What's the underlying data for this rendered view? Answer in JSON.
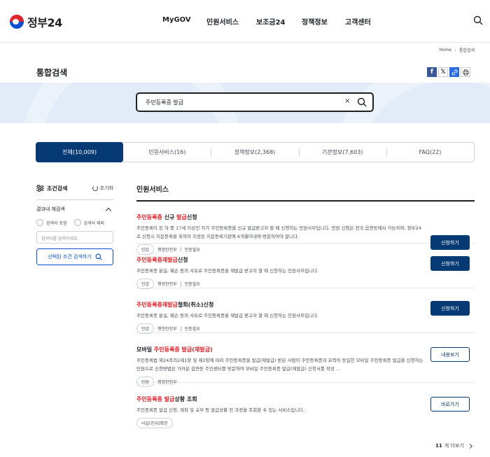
{
  "header": {
    "logo_text": "정부24",
    "nav": [
      "MyGOV",
      "민원서비스",
      "보조금24",
      "정책정보",
      "고객센터"
    ]
  },
  "breadcrumb": [
    "Home",
    "통합검색"
  ],
  "page_title": "통합검색",
  "search": {
    "value": "주민등록증 발급"
  },
  "tabs": [
    {
      "label": "전체(10,009)",
      "active": true
    },
    {
      "label": "민원서비스(16)",
      "active": false
    },
    {
      "label": "정책정보(2,368)",
      "active": false
    },
    {
      "label": "기관정보(7,603)",
      "active": false
    },
    {
      "label": "FAQ(22)",
      "active": false
    }
  ],
  "filter": {
    "title": "조건검색",
    "reset": "초기화",
    "section": "결과내 재검색",
    "option_include": "검색어 포함",
    "option_exclude": "검색어 제외",
    "input_placeholder": "검색어를 입력하세요.",
    "apply_button": "선택된 조건 검색하기"
  },
  "results": {
    "section_title": "민원서비스",
    "items": [
      {
        "title_pre": "",
        "title_hl1": "주민등록증",
        "title_mid": " 신규 ",
        "title_hl2": "발급",
        "title_post": "신청",
        "desc": "주민등록이 된 자 중 17세 이상인 자가 주민등록증을 신규 발급받고자 할 때 신청하는 민원사무입니다. 민원 신청은 전국 읍면동에서 가능하며, 정부24로 신청시 지문등록을 위하여 지정된 지문등록기관에 6개월이내에 방문하여야 합니다.",
        "badge": "인감",
        "agency": "행정안전부",
        "auth": "인증필요",
        "action": "신청하기"
      },
      {
        "title_pre": "",
        "title_hl1": "주민등록증",
        "title_mid": "재",
        "title_hl2": "발급",
        "title_post": "신청",
        "desc": "주민등록증 분실, 훼손 등의 사유로 주민등록증을 재발급 받고자 할 때 신청하는 민원사무입니다.",
        "badge": "인감",
        "agency": "행정안전부",
        "auth": "인증필요",
        "action": "신청하기"
      },
      {
        "title_pre": "",
        "title_hl1": "주민등록증",
        "title_mid": "재",
        "title_hl2": "발급",
        "title_post": "철회(취소)신청",
        "desc": "주민등록증 분실, 훼손 등의 사유로 주민등록증을 재발급 받고자 할 때 신청하는 민원사무입니다.",
        "badge": "인감",
        "agency": "행정안전부",
        "auth": "인증필요",
        "action": "신청하기"
      },
      {
        "title_pre": "모바일 ",
        "title_hl1": "주민등록증",
        "title_mid": " ",
        "title_hl2": "발급",
        "title_post": "(재발급)",
        "desc": "주민등록법 제24조의2제1항 및 제2항에 따라 주민등록증을 발급(재발급) 받은 사람이 주민등록증과 효력이 동일한 모바일 주민등록증 발급을 신청하는 민원으로 신청방법은 가까운 읍면동 주민센터를 방문하여 모바일 주민등록증 발급(재발급) 신청서를 작성 ...",
        "badge": "민원",
        "agency": "행정안전부",
        "auth": "",
        "action": "내용보기"
      },
      {
        "title_pre": "",
        "title_hl1": "주민등록증",
        "title_mid": " ",
        "title_hl2": "발급",
        "title_post": "상황 조회",
        "desc": "주민등록증 발급 신청, 제작 및 교부 등 발급상황 전 과정을 조회할 수 있는 서비스입니다.",
        "badge": "사실(진위)확인",
        "agency": "",
        "auth": "",
        "action": "바로가기"
      }
    ],
    "more_count": "11",
    "more_label": "개 더보기"
  },
  "share": [
    "f",
    "X",
    "link",
    "print"
  ],
  "colors": {
    "primary": "#063a74",
    "highlight": "#de1f26",
    "band": "#e1ecf8"
  }
}
